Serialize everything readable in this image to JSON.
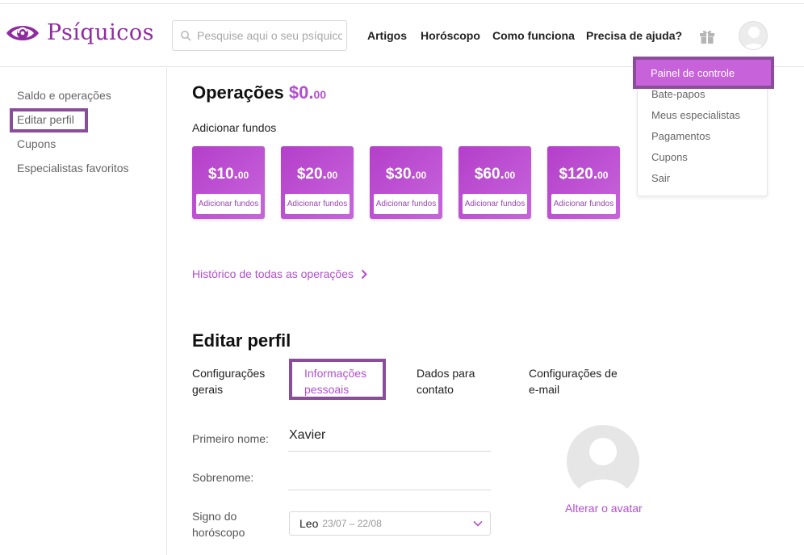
{
  "header": {
    "logo_text": "Psíquicos",
    "search_placeholder": "Pesquise aqui o seu psíquico",
    "nav": [
      "Artigos",
      "Horóscopo",
      "Como funciona",
      "Precisa de ajuda?"
    ]
  },
  "sidebar": {
    "items": [
      "Saldo e operações",
      "Editar perfil",
      "Cupons",
      "Especialistas favoritos"
    ]
  },
  "operations": {
    "title": "Operações",
    "balance_main": "$0.",
    "balance_cents": "00",
    "add_funds_label": "Adicionar fundos",
    "cards": [
      {
        "main": "$10.",
        "cents": "00",
        "button": "Adicionar fundos"
      },
      {
        "main": "$20.",
        "cents": "00",
        "button": "Adicionar fundos"
      },
      {
        "main": "$30.",
        "cents": "00",
        "button": "Adicionar fundos"
      },
      {
        "main": "$60.",
        "cents": "00",
        "button": "Adicionar fundos"
      },
      {
        "main": "$120.",
        "cents": "00",
        "button": "Adicionar fundos"
      }
    ],
    "history_link": "Histórico de todas as operações"
  },
  "edit_profile": {
    "title": "Editar perfil",
    "tabs": [
      {
        "line1": "Configurações",
        "line2": "gerais"
      },
      {
        "line1": "Informações",
        "line2": "pessoais"
      },
      {
        "line1": "Dados para",
        "line2": "contato"
      },
      {
        "line1": "Configurações de",
        "line2": "e-mail"
      }
    ],
    "first_name_label": "Primeiro nome:",
    "first_name_value": "Xavier",
    "last_name_label": "Sobrenome:",
    "last_name_value": "",
    "sign_label_line1": "Signo do",
    "sign_label_line2": "horóscopo",
    "sign_value": "Leo",
    "sign_range": "23/07 – 22/08",
    "change_avatar": "Alterar o avatar"
  },
  "user_menu": {
    "items": [
      "Painel de controle",
      "Bate-papos",
      "Meus especialistas",
      "Pagamentos",
      "Cupons",
      "Sair"
    ]
  },
  "colors": {
    "brand": "#8f2aa0",
    "accent": "#b24fcf",
    "highlight_border": "#8a4d9a"
  }
}
